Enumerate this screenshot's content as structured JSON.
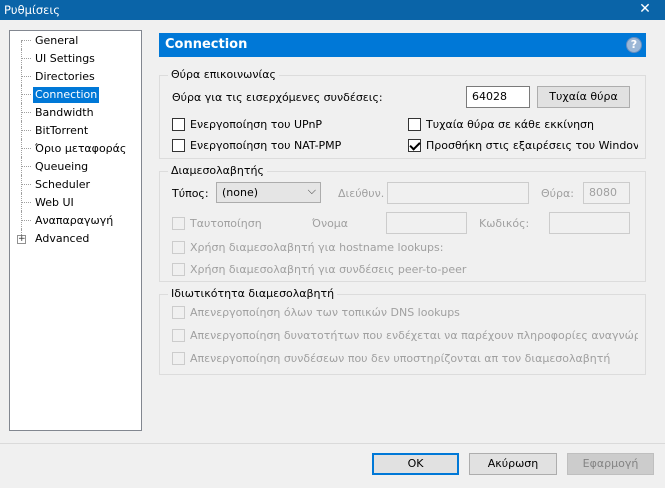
{
  "window": {
    "title": "Ρυθμίσεις",
    "close_glyph": "✕"
  },
  "sidebar": {
    "items": [
      {
        "label": "General"
      },
      {
        "label": "UI Settings"
      },
      {
        "label": "Directories"
      },
      {
        "label": "Connection",
        "selected": true
      },
      {
        "label": "Bandwidth"
      },
      {
        "label": "BitTorrent"
      },
      {
        "label": "Όριο μεταφοράς"
      },
      {
        "label": "Queueing"
      },
      {
        "label": "Scheduler"
      },
      {
        "label": "Web UI"
      },
      {
        "label": "Αναπαραγωγή"
      },
      {
        "label": "Advanced",
        "expandable": true,
        "expander": "+"
      }
    ]
  },
  "header": {
    "title": "Connection",
    "help_glyph": "?"
  },
  "listening_port": {
    "group_title": "Θύρα επικοινωνίας",
    "incoming_label": "Θύρα για τις εισερχόμενες συνδέσεις:",
    "port_value": "64028",
    "random_button": "Τυχαία θύρα",
    "upnp": {
      "label": "Ενεργοποίηση του UPnP",
      "checked": false
    },
    "nat_pmp": {
      "label": "Ενεργοποίηση του NAT-PMP",
      "checked": false
    },
    "random_each_start": {
      "label": "Τυχαία θύρα σε κάθε εκκίνηση",
      "checked": false
    },
    "firewall_exception": {
      "label": "Προσθήκη στις εξαιρέσεις του Windov",
      "checked": true
    }
  },
  "proxy": {
    "group_title": "Διαμεσολαβητής",
    "type_label": "Τύπος:",
    "type_value": "(none)",
    "dropdown_glyph": "⌵",
    "host_label": "Διεύθυν.",
    "host_value": "",
    "port_label": "Θύρα:",
    "port_value": "8080",
    "auth": {
      "label": "Ταυτοποίηση",
      "checked": false
    },
    "username_label": "Όνομα",
    "username_value": "",
    "password_label": "Κωδικός:",
    "password_value": "",
    "hostname_lookups": {
      "label": "Χρήση διαμεσολαβητή για hostname lookups:",
      "checked": false
    },
    "peer_connections": {
      "label": "Χρήση διαμεσολαβητή για συνδέσεις peer-to-peer",
      "checked": false
    }
  },
  "privacy": {
    "group_title": "Ιδιωτικότητα διαμεσολαβητή",
    "disable_dns": {
      "label": "Απενεργοποίηση όλων των τοπικών DNS lookups",
      "checked": false
    },
    "disable_leaky": {
      "label": "Απενεργοποίηση δυνατοτήτων που ενδέχεται να παρέχουν πληροφορίες αναγνώρι",
      "checked": false
    },
    "disable_unsupported": {
      "label": "Απενεργοποίηση συνδέσεων που δεν υποστηρίζονται απ τον διαμεσολαβητή",
      "checked": false
    }
  },
  "footer": {
    "ok": "OK",
    "cancel": "Ακύρωση",
    "apply": "Εφαρμογή"
  }
}
